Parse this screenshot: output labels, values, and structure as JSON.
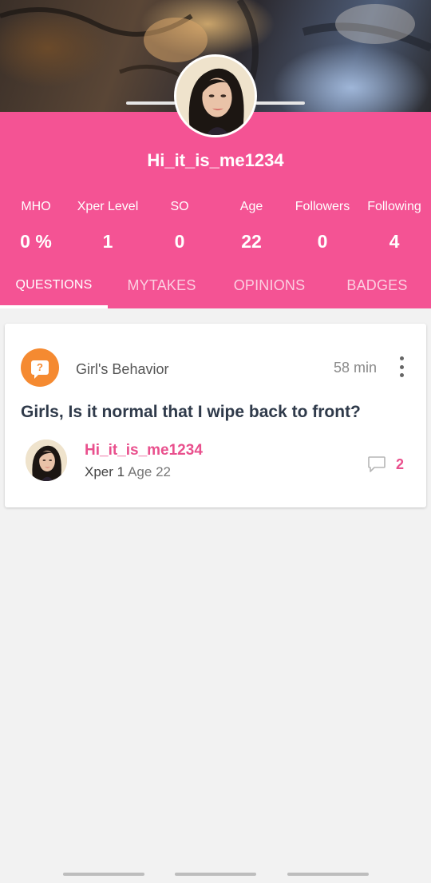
{
  "profile": {
    "username": "Hi_it_is_me1234"
  },
  "stats": [
    {
      "label": "MHO",
      "value": "0 %"
    },
    {
      "label": "Xper Level",
      "value": "1"
    },
    {
      "label": "SO",
      "value": "0"
    },
    {
      "label": "Age",
      "value": "22"
    },
    {
      "label": "Followers",
      "value": "0"
    },
    {
      "label": "Following",
      "value": "4"
    }
  ],
  "tabs": [
    {
      "label": "QUESTIONS",
      "active": true
    },
    {
      "label": "MYTAKES",
      "active": false
    },
    {
      "label": "OPINIONS",
      "active": false
    },
    {
      "label": "BADGES",
      "active": false
    }
  ],
  "post": {
    "category_icon": "question-bubble-icon",
    "category_icon_glyph": "?",
    "category": "Girl's Behavior",
    "time": "58 min",
    "title": "Girls, Is it normal that I wipe back to front?",
    "author": "Hi_it_is_me1234",
    "xper": "Xper 1",
    "age": "Age 22",
    "comment_count": "2"
  },
  "colors": {
    "brand_pink": "#f45394",
    "accent_pink": "#e9508d",
    "category_orange": "#f58a31"
  }
}
